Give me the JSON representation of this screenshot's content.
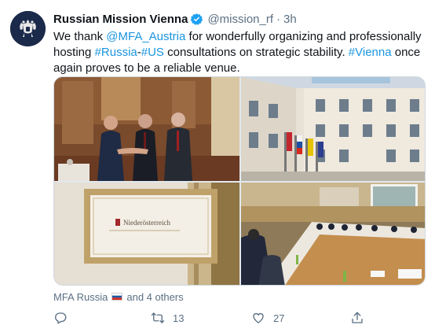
{
  "author": {
    "display_name": "Russian Mission Vienna",
    "handle": "@mission_rf",
    "separator": "·",
    "time": "3h",
    "avatar_icon": "coat-of-arms-icon",
    "verified_icon": "verified-badge-icon"
  },
  "tweet": {
    "segments": [
      {
        "text": "We thank ",
        "link": false
      },
      {
        "text": "@MFA_Austria",
        "link": true
      },
      {
        "text": " for wonderfully organizing and professionally hosting ",
        "link": false
      },
      {
        "text": "#Russia",
        "link": true
      },
      {
        "text": "-",
        "link": false
      },
      {
        "text": "#US",
        "link": true
      },
      {
        "text": " consultations on strategic stability. ",
        "link": false
      },
      {
        "text": "#Vienna",
        "link": true
      },
      {
        "text": " once again proves to be a reliable venue.",
        "link": false
      }
    ]
  },
  "media": {
    "photos": [
      {
        "name": "handshake-photo"
      },
      {
        "name": "palace-courtyard-photo"
      },
      {
        "name": "nameplate-photo",
        "sign_text": "Niederösterreich"
      },
      {
        "name": "conference-table-photo"
      }
    ]
  },
  "tagged": {
    "first_user": "MFA Russia",
    "flag_icon": "russia-flag-icon",
    "rest": "and 4 others"
  },
  "actions": {
    "reply": {
      "icon": "reply-icon",
      "count": ""
    },
    "retweet": {
      "icon": "retweet-icon",
      "count": "13"
    },
    "like": {
      "icon": "heart-icon",
      "count": "27"
    },
    "share": {
      "icon": "share-icon",
      "count": ""
    }
  },
  "colors": {
    "link": "#1b95e0",
    "secondary_text": "#5b7083",
    "primary_text": "#0f1419",
    "verified": "#1da1f2"
  }
}
